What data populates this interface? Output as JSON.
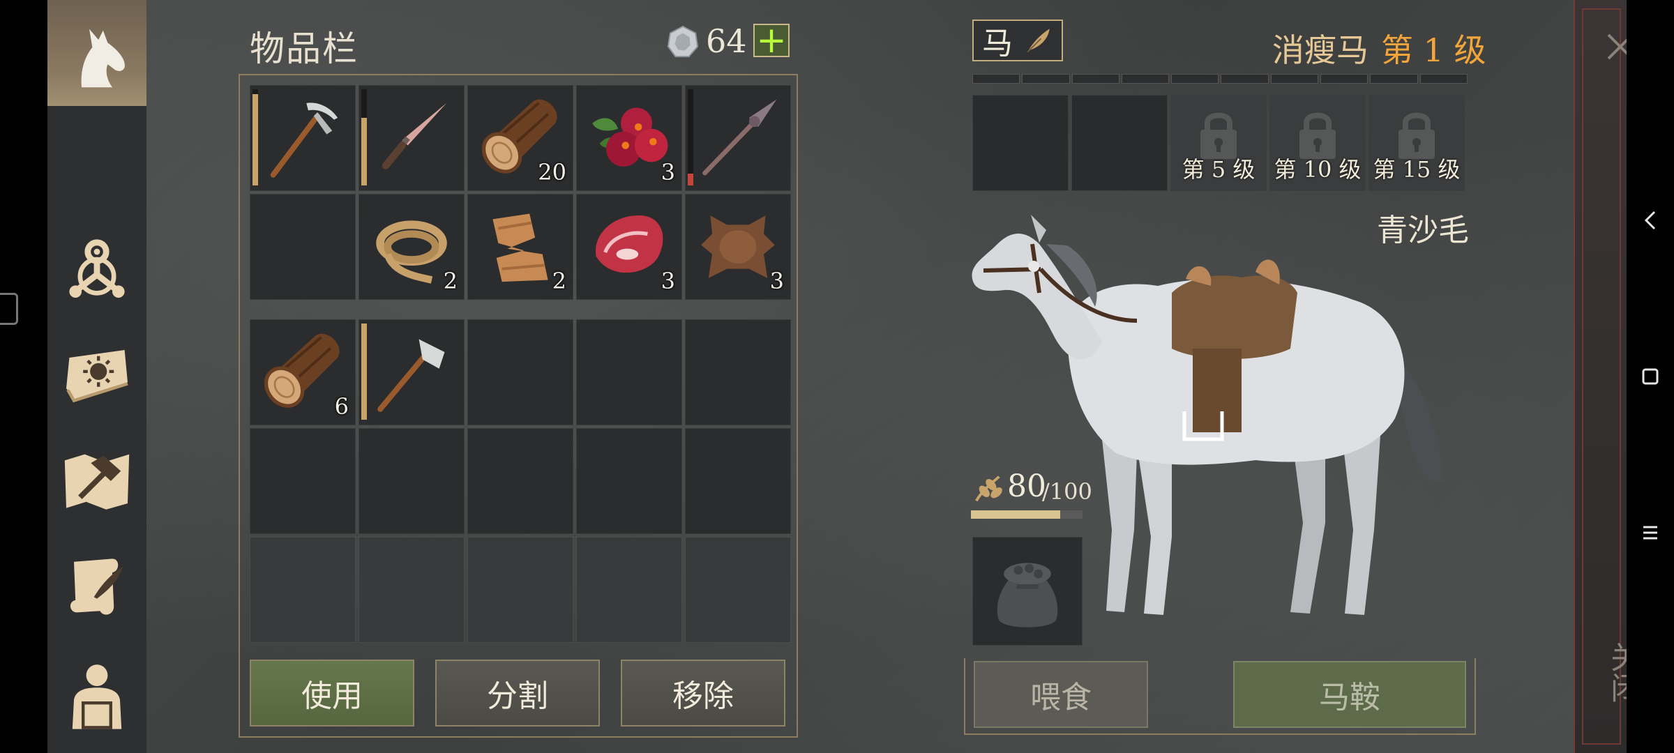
{
  "inventory": {
    "title": "物品栏",
    "currency": {
      "icon": "silver-coin-icon",
      "amount": "64",
      "add_label": "+"
    },
    "bag_slots": [
      {
        "icon": "pickaxe-icon",
        "quantity": "",
        "durability": 0.95
      },
      {
        "icon": "knife-icon",
        "quantity": "",
        "durability": 0.7
      },
      {
        "icon": "log-icon",
        "quantity": "20"
      },
      {
        "icon": "berries-icon",
        "quantity": "3"
      },
      {
        "icon": "spear-icon",
        "quantity": "",
        "durability": 0.12
      },
      {
        "icon": "",
        "quantity": ""
      },
      {
        "icon": "rope-icon",
        "quantity": "2"
      },
      {
        "icon": "fiber-cloth-icon",
        "quantity": "2"
      },
      {
        "icon": "raw-meat-icon",
        "quantity": "3"
      },
      {
        "icon": "animal-hide-icon",
        "quantity": "3"
      }
    ],
    "pocket_slots": [
      {
        "icon": "log-icon",
        "quantity": "6"
      },
      {
        "icon": "hatchet-icon",
        "quantity": "",
        "durability": 1.0
      }
    ],
    "buttons": {
      "use": "使用",
      "split": "分割",
      "remove": "移除"
    }
  },
  "horse": {
    "tab_label": "马",
    "name": "消瘦马",
    "level": "第 1 级",
    "xp_segments": 10,
    "equip_slots": [
      {
        "locked": false,
        "label": ""
      },
      {
        "locked": false,
        "label": ""
      },
      {
        "locked": true,
        "label": "第 5 级"
      },
      {
        "locked": true,
        "label": "第 10 级"
      },
      {
        "locked": true,
        "label": "第 15 级"
      }
    ],
    "coat": "青沙毛",
    "food": {
      "value": "80",
      "max": "/100",
      "fraction": 0.8
    },
    "buttons": {
      "feed": "喂食",
      "saddle": "马鞍"
    }
  },
  "close_label": "关闭",
  "colors": {
    "accent_orange": "#f1a53a",
    "use_button": "#66764d",
    "plus_green": "#b7ff3a"
  }
}
